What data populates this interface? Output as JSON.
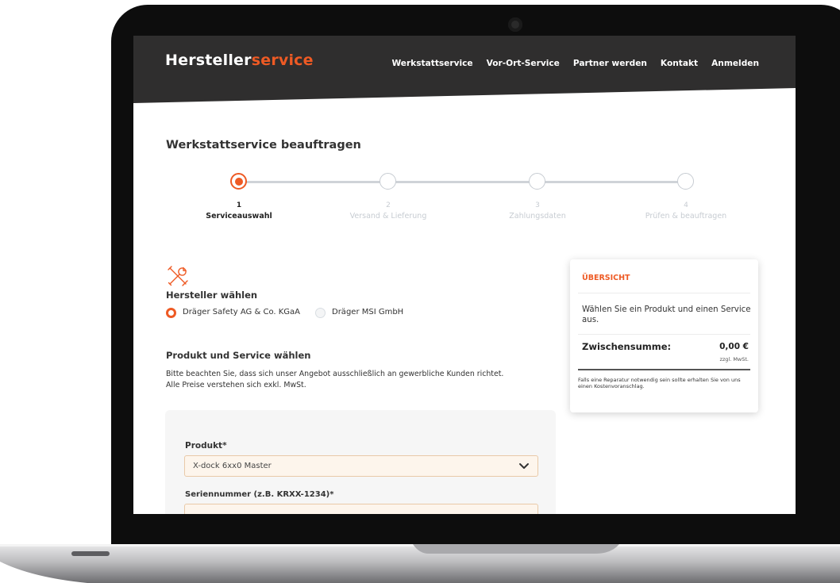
{
  "brand": {
    "name_main": "Hersteller",
    "name_accent": "service"
  },
  "nav": {
    "items": [
      "Werkstattservice",
      "Vor-Ort-Service",
      "Partner werden",
      "Kontakt",
      "Anmelden"
    ]
  },
  "page": {
    "title": "Werkstattservice beauftragen"
  },
  "stepper": {
    "current_step": 1,
    "steps": [
      {
        "number": "1",
        "label": "Serviceauswahl"
      },
      {
        "number": "2",
        "label": "Versand & Lieferung"
      },
      {
        "number": "3",
        "label": "Zahlungsdaten"
      },
      {
        "number": "4",
        "label": "Prüfen & beauftragen"
      }
    ]
  },
  "manufacturer": {
    "icon": "tools-icon",
    "heading": "Hersteller wählen",
    "options": [
      {
        "label": "Dräger Safety AG & Co. KGaA",
        "selected": true
      },
      {
        "label": "Dräger MSI GmbH",
        "selected": false
      }
    ]
  },
  "product_section": {
    "heading": "Produkt und Service wählen",
    "note_line1": "Bitte beachten Sie, dass sich unser Angebot ausschließlich an gewerbliche Kunden richtet.",
    "note_line2": "Alle Preise verstehen sich exkl. MwSt."
  },
  "form": {
    "product_label": "Produkt*",
    "product_value": "X-dock 6xx0 Master",
    "serial_label": "Seriennummer (z.B. KRXX-1234)*",
    "serial_value": ""
  },
  "summary": {
    "title": "ÜBERSICHT",
    "message": "Wählen Sie ein Produkt und einen Service aus.",
    "subtotal_label": "Zwischensumme:",
    "subtotal_value": "0,00 €",
    "tax_note": "zzgl. MwSt.",
    "footnote": "Falls eine Reparatur notwendig sein sollte erhalten Sie von uns einen Kostenvoranschlag."
  },
  "colors": {
    "accent": "#ee5a24",
    "header_bg": "#2f2e2e",
    "text": "#333333",
    "muted": "#c7ccd2"
  }
}
